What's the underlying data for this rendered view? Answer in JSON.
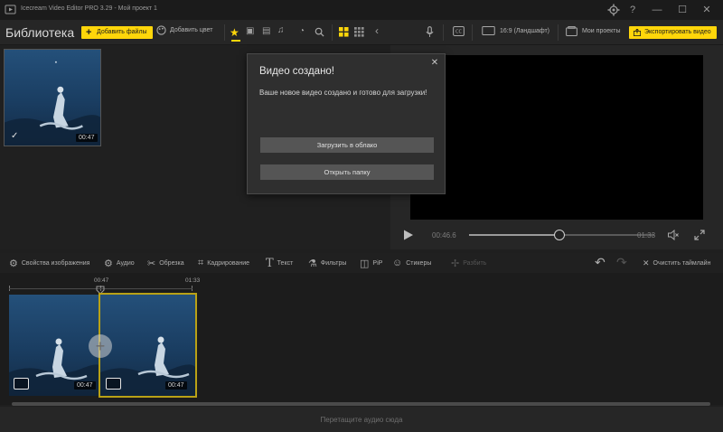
{
  "window": {
    "title": "Icecream Video Editor PRO 3.29  -  Мой проект 1",
    "controls": {
      "settings_icon": "gear-icon",
      "help_label": "?",
      "minimize_label": "—",
      "maximize_label": "☐",
      "close_label": "✕"
    }
  },
  "toolbar": {
    "library_title": "Библиотека",
    "add_files_label": "Добавить файлы",
    "add_color_label": "Добавить цвет",
    "aspect_label": "16:9 (Ландшафт)",
    "my_projects_label": "Мои проекты",
    "export_label": "Экспортировать видео",
    "accent_color": "#ffd60a"
  },
  "library": {
    "clips": [
      {
        "duration": "00:47",
        "checked": true
      }
    ]
  },
  "preview": {
    "current_time": "00:46.6",
    "total_time": "01:33",
    "progress": 0.49
  },
  "tools": [
    {
      "label": "Свойства изображения",
      "icon": "image-properties-icon"
    },
    {
      "label": "Аудио",
      "icon": "audio-icon"
    },
    {
      "label": "Обрезка",
      "icon": "scissors-icon"
    },
    {
      "label": "Кадрирование",
      "icon": "crop-icon"
    },
    {
      "label": "Текст",
      "icon": "text-icon"
    },
    {
      "label": "Фильтры",
      "icon": "filters-icon"
    },
    {
      "label": "PiP",
      "icon": "pip-icon"
    },
    {
      "label": "Стикеры",
      "icon": "stickers-icon"
    },
    {
      "label": "Разбить",
      "icon": "split-icon",
      "disabled": true
    }
  ],
  "timeline": {
    "clear_label": "Очистить таймлайн",
    "ruler": [
      "00:47",
      "01:33"
    ],
    "clips": [
      {
        "duration": "00:47"
      },
      {
        "duration": "00:47",
        "selected": true
      }
    ],
    "audio_hint": "Перетащите аудио сюда"
  },
  "dialog": {
    "title": "Видео создано!",
    "message": "Ваше новое видео создано и готово для загрузки!",
    "upload_label": "Загрузить в облако",
    "open_folder_label": "Открыть папку"
  }
}
